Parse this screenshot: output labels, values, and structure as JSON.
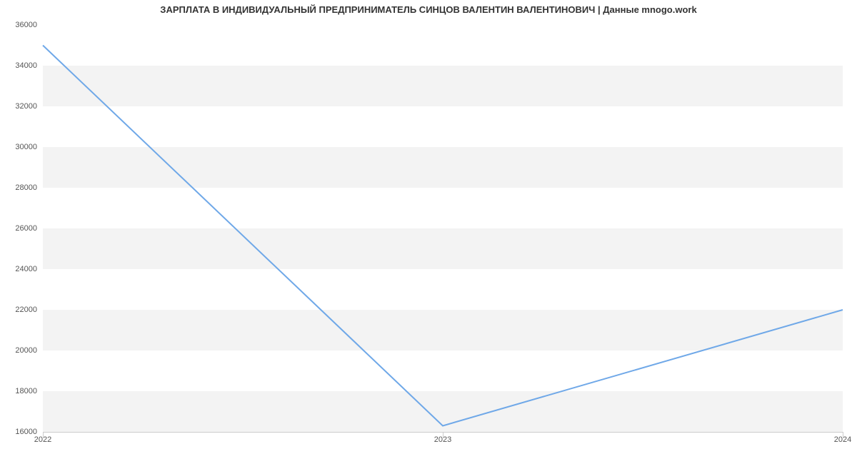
{
  "chart_data": {
    "type": "line",
    "title": "ЗАРПЛАТА В ИНДИВИДУАЛЬНЫЙ ПРЕДПРИНИМАТЕЛЬ СИНЦОВ ВАЛЕНТИН ВАЛЕНТИНОВИЧ | Данные mnogo.work",
    "x": [
      2022,
      2023,
      2024
    ],
    "values": [
      35000,
      16300,
      22000
    ],
    "x_ticks": [
      2022,
      2023,
      2024
    ],
    "y_ticks": [
      16000,
      18000,
      20000,
      22000,
      24000,
      26000,
      28000,
      30000,
      32000,
      34000,
      36000
    ],
    "xlim": [
      2022,
      2024
    ],
    "ylim": [
      16000,
      36000
    ],
    "xlabel": "",
    "ylabel": ""
  }
}
